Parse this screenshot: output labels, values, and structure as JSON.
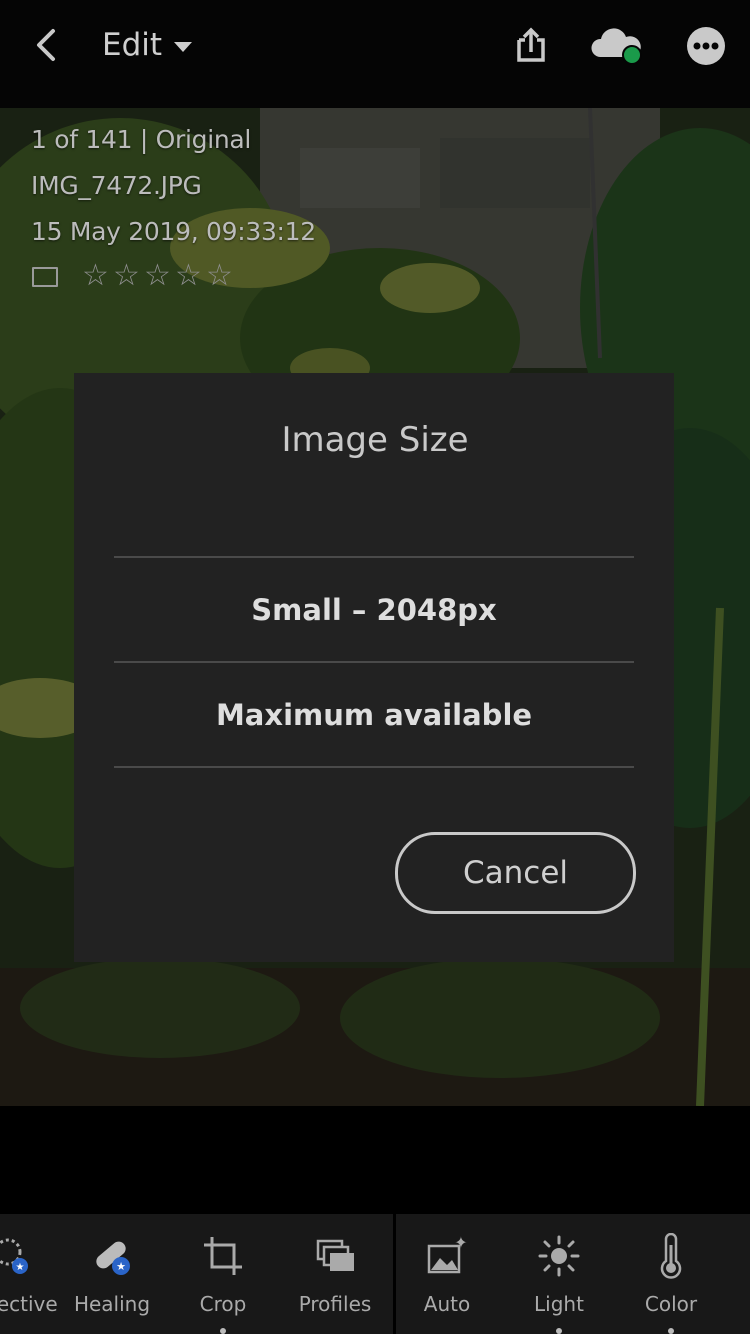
{
  "header": {
    "back_icon": "chevron-left-icon",
    "title": "Edit",
    "share_icon": "share-icon",
    "cloud_icon": "cloud-sync-icon",
    "cloud_status_color": "#1a9a4a",
    "more_icon": "more-icon"
  },
  "photo_info": {
    "count": "1 of 141 | Original",
    "filename": "IMG_7472.JPG",
    "datetime": "15 May 2019, 09:33:12",
    "flag_icon": "flag-icon",
    "rating": 0,
    "max_rating": 5
  },
  "dialog": {
    "title": "Image Size",
    "options": [
      {
        "label": "Small – 2048px"
      },
      {
        "label": "Maximum available"
      }
    ],
    "cancel_label": "Cancel"
  },
  "toolbar": {
    "tools": [
      {
        "label": "Selective",
        "icon": "selective-icon"
      },
      {
        "label": "Healing",
        "icon": "healing-icon"
      },
      {
        "label": "Crop",
        "icon": "crop-icon"
      },
      {
        "label": "Profiles",
        "icon": "profiles-icon"
      },
      {
        "label": "Auto",
        "icon": "auto-icon"
      },
      {
        "label": "Light",
        "icon": "light-icon"
      },
      {
        "label": "Color",
        "icon": "color-icon"
      }
    ]
  }
}
